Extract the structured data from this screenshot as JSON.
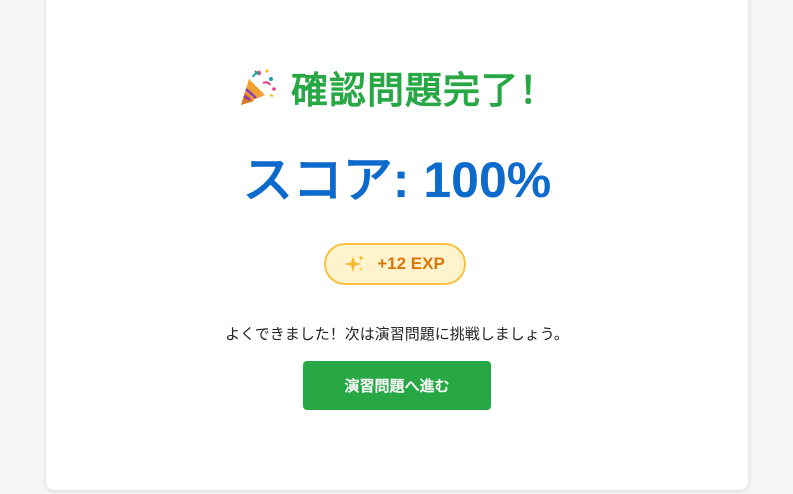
{
  "colors": {
    "title": "#28a745",
    "score": "#0d6acd",
    "badge_bg": "#fff3cd",
    "badge_border": "#f5c242",
    "badge_text": "#d97706",
    "button_bg": "#28a745"
  },
  "header": {
    "icon": "party-popper-icon",
    "title": "確認問題完了！"
  },
  "score": {
    "text": "スコア: 100%",
    "value_percent": 100
  },
  "reward": {
    "icon": "sparkles-icon",
    "label": "+12 EXP"
  },
  "message": "よくできました！次は演習問題に挑戦しましょう。",
  "actions": {
    "next_label": "演習問題へ進む"
  }
}
